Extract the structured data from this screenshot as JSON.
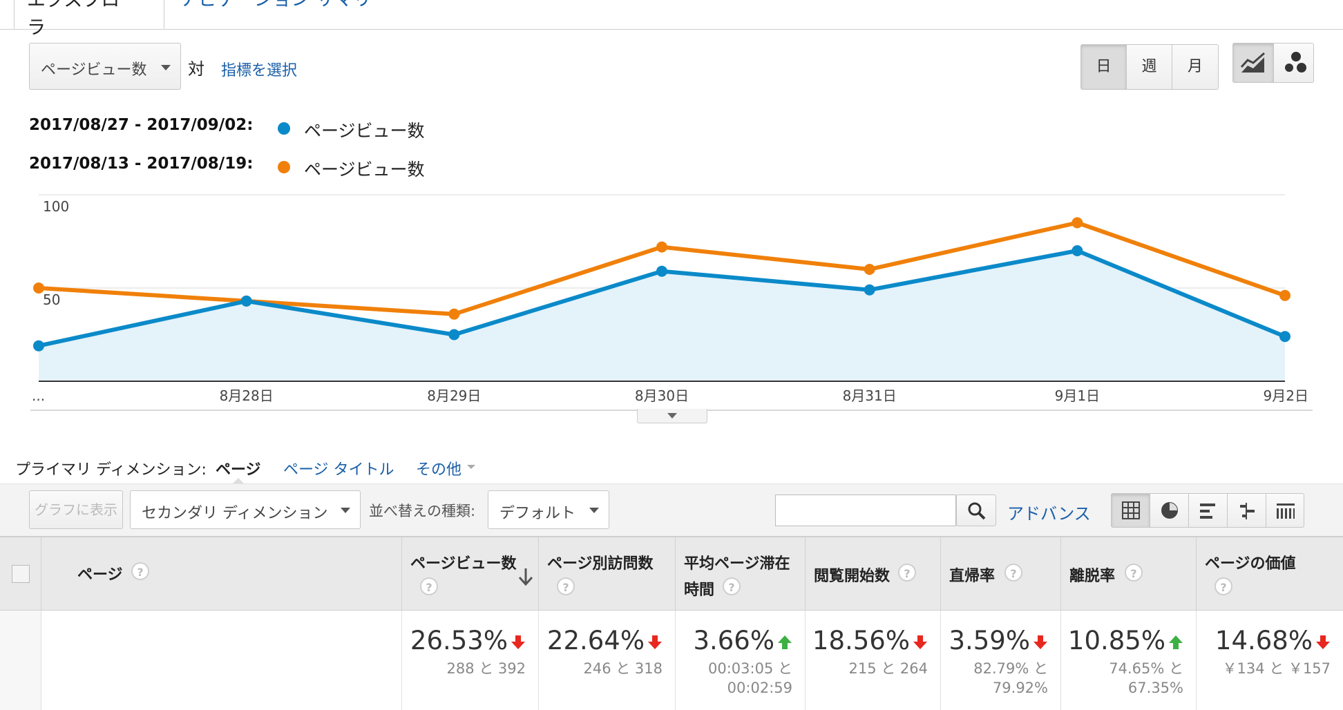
{
  "tabs": {
    "explorer": "エクスプローラ",
    "navigation_summary": "ナビゲーション サマリー"
  },
  "controls": {
    "metric_select": "ページビュー数",
    "vs": "対",
    "select_metric_link": "指標を選択",
    "period_buttons": [
      "日",
      "週",
      "月"
    ]
  },
  "legend": [
    {
      "range": "2017/08/27 - 2017/09/02:",
      "label": "ページビュー数",
      "color": "#0b8ac9"
    },
    {
      "range": "2017/08/13 - 2017/08/19:",
      "label": "ページビュー数",
      "color": "#f0800a"
    }
  ],
  "chart_data": {
    "type": "line",
    "x": [
      "...",
      "8月28日",
      "8月29日",
      "8月30日",
      "8月31日",
      "9月1日",
      "9月2日"
    ],
    "y_ticks": [
      "100",
      "50"
    ],
    "ylim": [
      0,
      100
    ],
    "series": [
      {
        "values": [
          19,
          43,
          25,
          59,
          49,
          70,
          24
        ],
        "color": "#0b8ac9",
        "area": true
      },
      {
        "values": [
          50,
          43,
          36,
          72,
          60,
          85,
          46
        ],
        "color": "#f0800a",
        "area": false
      }
    ]
  },
  "dimensions": {
    "label": "プライマリ ディメンション:",
    "active": "ページ",
    "page_title": "ページ タイトル",
    "other": "その他"
  },
  "toolbar": {
    "plot_rows": "グラフに表示",
    "secondary_dimension": "セカンダリ ディメンション",
    "sort_label": "並べ替えの種類:",
    "sort_value": "デフォルト",
    "search_placeholder": "",
    "advanced": "アドバンス"
  },
  "table": {
    "columns": [
      {
        "title": "ページ"
      },
      {
        "title": "ページビュー数"
      },
      {
        "title": "ページ別訪問数"
      },
      {
        "title": "平均ページ滞在",
        "title2": "時間"
      },
      {
        "title": "閲覧開始数"
      },
      {
        "title": "直帰率"
      },
      {
        "title": "離脱率"
      },
      {
        "title": "ページの価値"
      }
    ],
    "totals": [
      {
        "pct": "26.53%",
        "dir": "down",
        "sub1": "288 と 392"
      },
      {
        "pct": "22.64%",
        "dir": "down",
        "sub1": "246 と 318"
      },
      {
        "pct": "3.66%",
        "dir": "up",
        "sub1": "00:03:05 と",
        "sub2": "00:02:59"
      },
      {
        "pct": "18.56%",
        "dir": "down",
        "sub1": "215 と 264"
      },
      {
        "pct": "3.59%",
        "dir": "down",
        "sub1": "82.79% と",
        "sub2": "79.92%"
      },
      {
        "pct": "10.85%",
        "dir": "up",
        "sub1": "74.65% と",
        "sub2": "67.35%"
      },
      {
        "pct": "14.68%",
        "dir": "down",
        "sub1": "￥134 と ￥157"
      }
    ],
    "help_glyph": "?"
  }
}
